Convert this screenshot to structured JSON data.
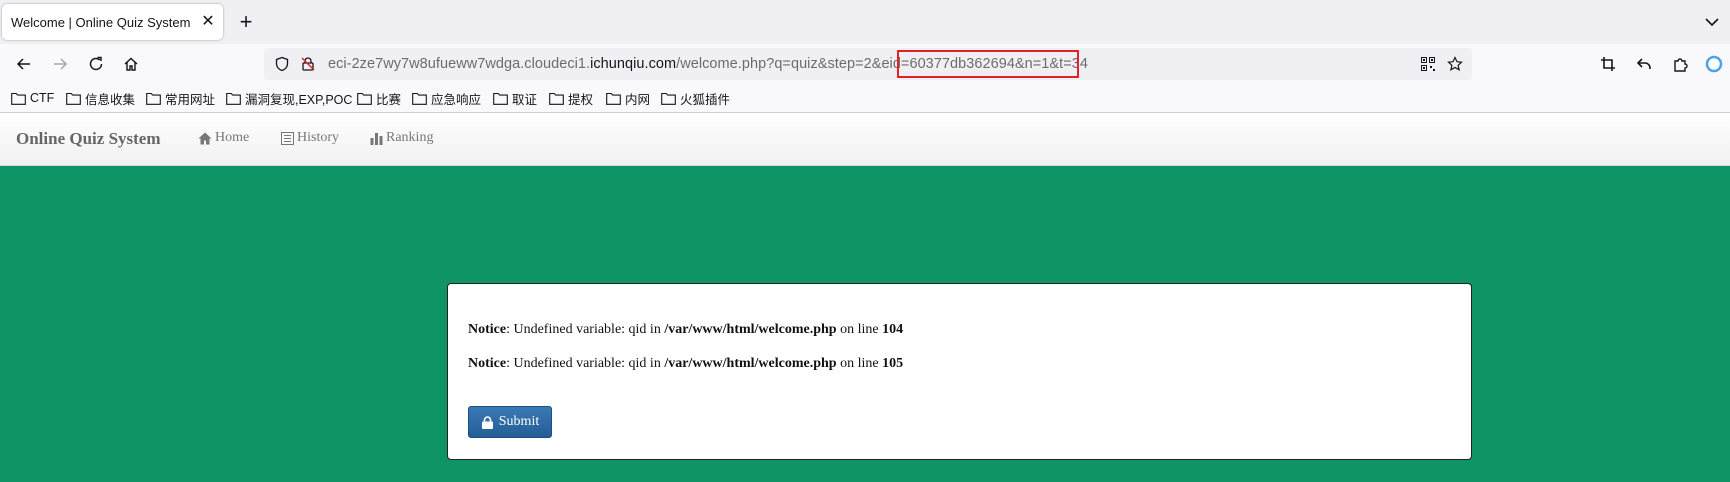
{
  "browser": {
    "tab_title": "Welcome | Online Quiz System",
    "tab_close": "✕",
    "new_tab": "+",
    "url": {
      "prefix": "eci-2ze7wy7w8ufueww7wdga.cloudeci1.",
      "domain": "ichunqiu.com",
      "path_before": "/welcome.php?q=quiz&step=2&",
      "path_highlight": "eid=60377db362694&n=1",
      "path_after": "&t=34"
    },
    "bookmarks": [
      "CTF",
      "信息收集",
      "常用网址",
      "漏洞复现,EXP,POC",
      "比赛",
      "应急响应",
      "取证",
      "提权",
      "内网",
      "火狐插件"
    ],
    "colors": {
      "highlight": "#e02424"
    }
  },
  "site": {
    "brand": "Online Quiz System",
    "nav": [
      "Home",
      "History",
      "Ranking"
    ]
  },
  "panel": {
    "notices": [
      {
        "label": "Notice",
        "text1": ": Undefined variable: qid in ",
        "path": "/var/www/html/welcome.php",
        "text2": " on line ",
        "line": "104"
      },
      {
        "label": "Notice",
        "text1": ": Undefined variable: qid in ",
        "path": "/var/www/html/welcome.php",
        "text2": " on line ",
        "line": "105"
      }
    ],
    "submit_label": "Submit"
  },
  "theme": {
    "background": "#0e9465",
    "button": "#2f6ca8"
  }
}
